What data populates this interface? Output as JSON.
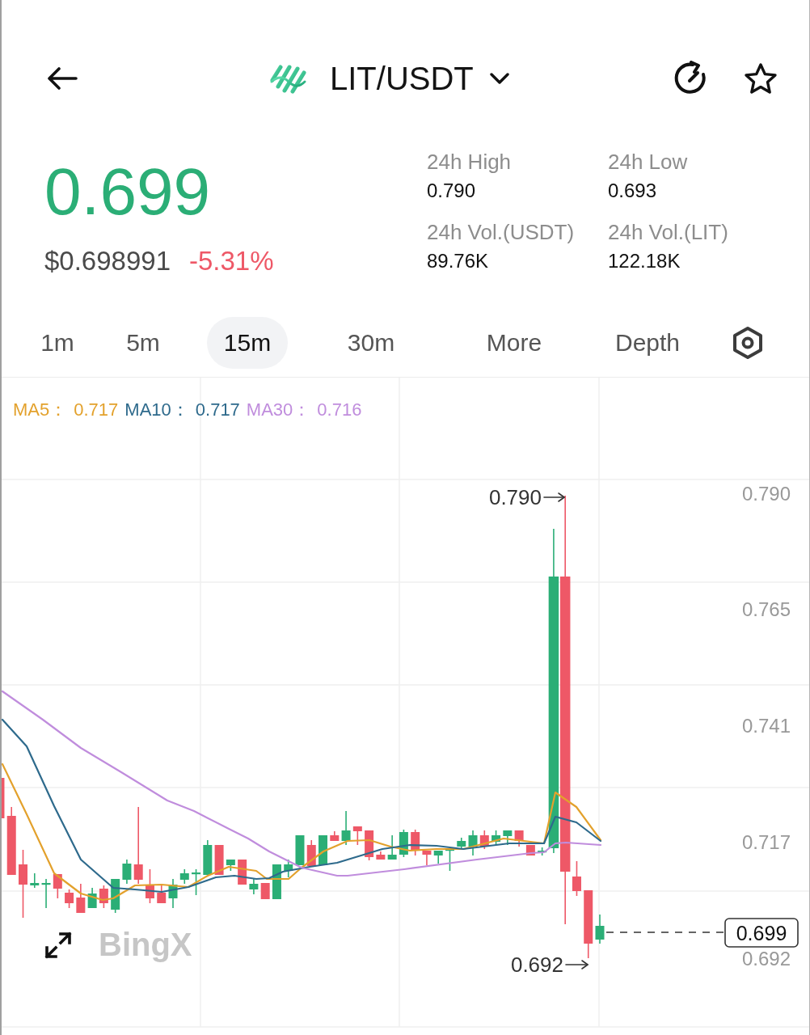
{
  "header": {
    "pair": "LIT/USDT"
  },
  "price": {
    "last": "0.699",
    "last_rising": true,
    "usd": "$0.698991",
    "change": "-5.31%",
    "change_rising": false
  },
  "stats": [
    {
      "label": "24h High",
      "value": "0.790"
    },
    {
      "label": "24h Low",
      "value": "0.693"
    },
    {
      "label": "24h Vol.(USDT)",
      "value": "89.76K"
    },
    {
      "label": "24h Vol.(LIT)",
      "value": "122.18K"
    }
  ],
  "intervals": [
    {
      "label": "1m",
      "selected": false
    },
    {
      "label": "5m",
      "selected": false
    },
    {
      "label": "15m",
      "selected": true
    },
    {
      "label": "30m",
      "selected": false
    },
    {
      "label": "More",
      "selected": false
    },
    {
      "label": "Depth",
      "selected": false
    }
  ],
  "chart": {
    "legend": [
      {
        "label": "MA5：",
        "value": "0.717",
        "color": "#e3a12c"
      },
      {
        "label": "MA10：",
        "value": "0.717",
        "color": "#2e6a8c"
      },
      {
        "label": "MA30：",
        "value": "0.716",
        "color": "#c08ddd"
      }
    ],
    "y_labels": [
      "0.790",
      "0.765",
      "0.741",
      "0.717",
      "0.692"
    ],
    "high_label": "0.790",
    "low_label": "0.692",
    "current_price": "0.699",
    "logo": "BingX"
  }
}
